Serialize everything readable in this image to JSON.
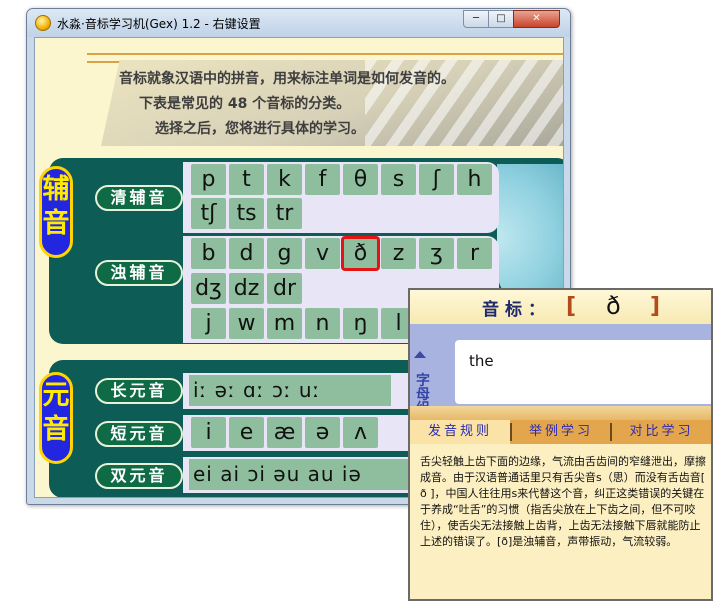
{
  "window": {
    "title": "水淼·音标学习机(Gex) 1.2 - 右键设置",
    "icon_label": "icon",
    "minimize_glyph": "─",
    "maximize_glyph": "□",
    "close_glyph": "✕"
  },
  "intro": {
    "line1": "音标就象汉语中的拼音，用来标注单词是如何发音的。",
    "line2": "下表是常见的 48 个音标的分类。",
    "line3": "选择之后，您将进行具体的学习。"
  },
  "consonants": {
    "section_label_top": "辅",
    "section_label_bottom": "音",
    "voiceless_label": "清辅音",
    "voiceless_row1": [
      "p",
      "t",
      "k",
      "f",
      "θ",
      "s",
      "ʃ",
      "h"
    ],
    "voiceless_row2": [
      "tʃ",
      "ts",
      "tr"
    ],
    "voiced_label": "浊辅音",
    "voiced_row1": [
      "b",
      "d",
      "g",
      "v",
      "ð",
      "z",
      "ʒ",
      "r"
    ],
    "voiced_row2": [
      "dʒ",
      "dz",
      "dr"
    ],
    "voiced_row3": [
      "j",
      "w",
      "m",
      "n",
      "ŋ",
      "l"
    ],
    "selected": "ð"
  },
  "vowels": {
    "section_label_top": "元",
    "section_label_bottom": "音",
    "long_label": "长元音",
    "long_row": "iː əː ɑː ɔː uː",
    "short_label": "短元音",
    "short_row": [
      "i",
      "e",
      "æ",
      "ə",
      "ʌ"
    ],
    "diphthong_label": "双元音",
    "diphthong_row": "ei ai ɔi əu au iə"
  },
  "popup": {
    "title": "音标：",
    "open_bracket": "[",
    "symbol": "ð",
    "close_bracket": "]",
    "vertical_label": [
      "字",
      "母",
      "组",
      "合"
    ],
    "example_word": "the",
    "tabs": [
      "发音规则",
      "举例学习",
      "对比学习"
    ],
    "active_tab": 0,
    "description": "舌尖轻触上齿下面的边缘，气流由舌齿间的窄缝泄出，摩擦成音。由于汉语普通话里只有舌尖音s（思）而没有舌齿音[ ð ]，中国人往往用s来代替这个音，纠正这类错误的关键在于养成“吐舌”的习惯（指舌尖放在上下齿之间，但不可咬住），使舌尖无法接触上齿背，上齿无法接触下唇就能防止上述的错误了。[ð]是浊辅音，声带振动，气流较弱。"
  },
  "colors": {
    "panel": "#0d5c56",
    "symbol_button": "#8fbe9f",
    "selection": "#e51414",
    "side_label_bg": "#2326e0",
    "side_label_text": "#ffeb00"
  }
}
